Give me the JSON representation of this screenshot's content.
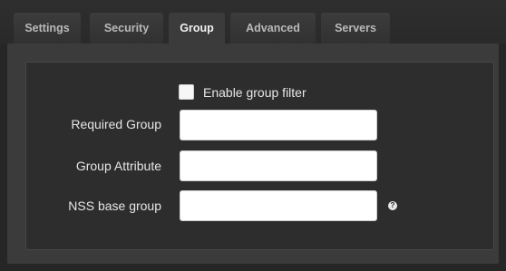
{
  "tabs": [
    {
      "label": "Settings"
    },
    {
      "label": "Security"
    },
    {
      "label": "Group"
    },
    {
      "label": "Advanced"
    },
    {
      "label": "Servers"
    }
  ],
  "active_tab": "Group",
  "form": {
    "enable_group_filter": {
      "label": "Enable group filter",
      "checked": false
    },
    "required_group": {
      "label": "Required Group",
      "value": ""
    },
    "group_attribute": {
      "label": "Group Attribute",
      "value": ""
    },
    "nss_base_group": {
      "label": "NSS base group",
      "value": ""
    },
    "help_icon": {
      "icon": "question-circle-icon",
      "glyph": "?"
    }
  }
}
